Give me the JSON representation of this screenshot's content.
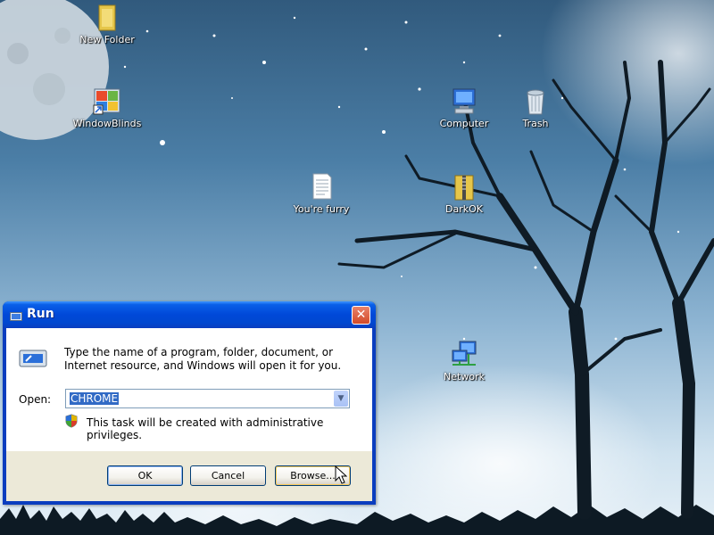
{
  "desktop": {
    "icons": [
      {
        "label": "New Folder",
        "icon": "folder-icon"
      },
      {
        "label": "WindowBlinds",
        "icon": "windowblinds-icon"
      },
      {
        "label": "Computer",
        "icon": "computer-icon"
      },
      {
        "label": "Trash",
        "icon": "trash-icon"
      },
      {
        "label": "You're furry",
        "icon": "text-document-icon"
      },
      {
        "label": "DarkOK",
        "icon": "zip-folder-icon"
      },
      {
        "label": "Network",
        "icon": "network-icon"
      }
    ]
  },
  "run_dialog": {
    "title": "Run",
    "description": "Type the name of a program, folder, document, or Internet resource, and Windows will open it for you.",
    "open_label": "Open:",
    "open_value": "CHROME",
    "privilege_note": "This task will be created with administrative privileges.",
    "buttons": {
      "ok": "OK",
      "cancel": "Cancel",
      "browse": "Browse..."
    }
  },
  "colors": {
    "titlebar": "#0048d8",
    "dialog_body": "#ece9d8",
    "selection": "#316ac5",
    "close_button": "#d34a28"
  }
}
